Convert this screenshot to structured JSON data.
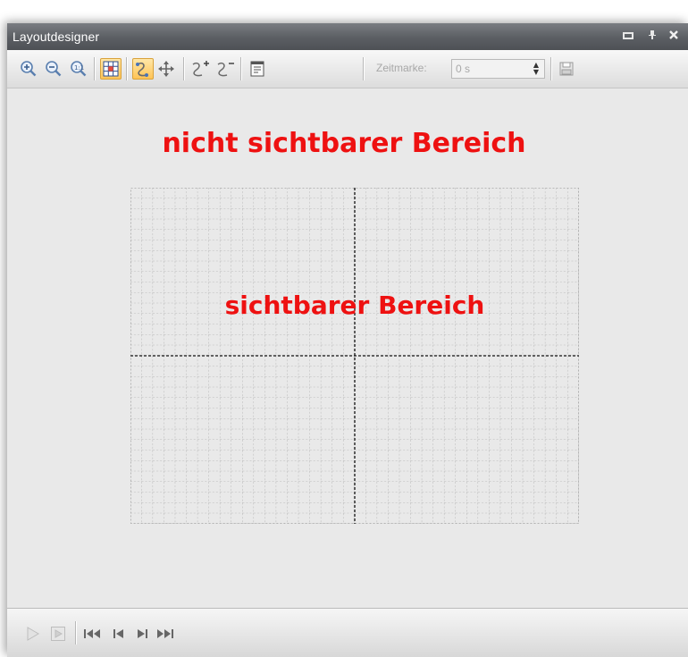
{
  "window": {
    "title": "Layoutdesigner",
    "controls": [
      "restore-icon",
      "pin-icon",
      "close-icon"
    ]
  },
  "toolbar": {
    "buttons": [
      {
        "name": "zoom-in-icon"
      },
      {
        "name": "zoom-out-icon"
      },
      {
        "name": "zoom-reset-icon"
      },
      {
        "name": "grid-icon",
        "active": true
      },
      {
        "name": "path-icon",
        "active": true
      },
      {
        "name": "move-icon"
      },
      {
        "name": "add-point-icon"
      },
      {
        "name": "remove-point-icon"
      },
      {
        "name": "properties-icon"
      }
    ],
    "zeitmarke_label": "Zeitmarke:",
    "zeitmarke_value": "0 s",
    "save_icon": "save-icon"
  },
  "canvas": {
    "outer_label": "nicht sichtbarer Bereich",
    "inner_label": "sichtbarer Bereich"
  },
  "playback": {
    "buttons": [
      "play-icon",
      "play-frame-icon",
      "skip-first-icon",
      "skip-previous-icon",
      "skip-next-icon",
      "skip-last-icon"
    ]
  },
  "colors": {
    "label_red": "#ee1111",
    "titlebar": "#5b5e63",
    "active_orange": "#ffc456"
  }
}
